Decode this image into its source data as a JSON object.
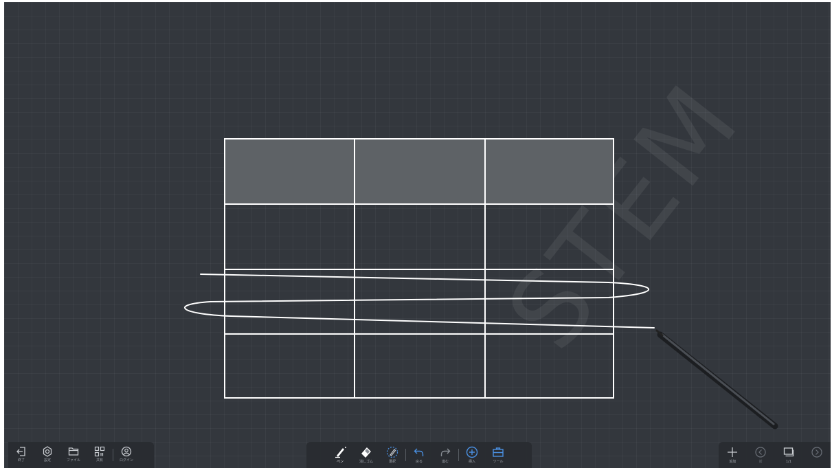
{
  "watermark": "STEM",
  "left_toolbar": {
    "items": [
      {
        "icon": "exit-icon",
        "label": "終了"
      },
      {
        "icon": "gear-icon",
        "label": "設定"
      },
      {
        "icon": "folder-icon",
        "label": "ファイル"
      },
      {
        "icon": "qr-code-icon",
        "label": "共有"
      },
      {
        "icon": "user-icon",
        "label": "ログイン"
      }
    ]
  },
  "center_toolbar": {
    "items": [
      {
        "icon": "pen-icon",
        "label": "ペン"
      },
      {
        "icon": "eraser-icon",
        "label": "消しゴム"
      },
      {
        "icon": "select-icon",
        "label": "選択"
      },
      {
        "icon": "undo-icon",
        "label": "戻る"
      },
      {
        "icon": "redo-icon",
        "label": "進む"
      },
      {
        "icon": "insert-icon",
        "label": "挿入"
      },
      {
        "icon": "toolbox-icon",
        "label": "ツール"
      }
    ]
  },
  "right_toolbar": {
    "items": [
      {
        "icon": "add-page-icon",
        "label": "追加"
      },
      {
        "icon": "prev-page-icon",
        "label": "前"
      },
      {
        "icon": "pages-icon",
        "label": "1/1"
      },
      {
        "icon": "next-page-icon",
        "label": ""
      }
    ]
  },
  "colors": {
    "background": "#33373d",
    "table_line": "#ffffff",
    "header_fill": "#5e6266",
    "toolbar_bg": "#282b30",
    "active_tool": "#ffffff"
  }
}
